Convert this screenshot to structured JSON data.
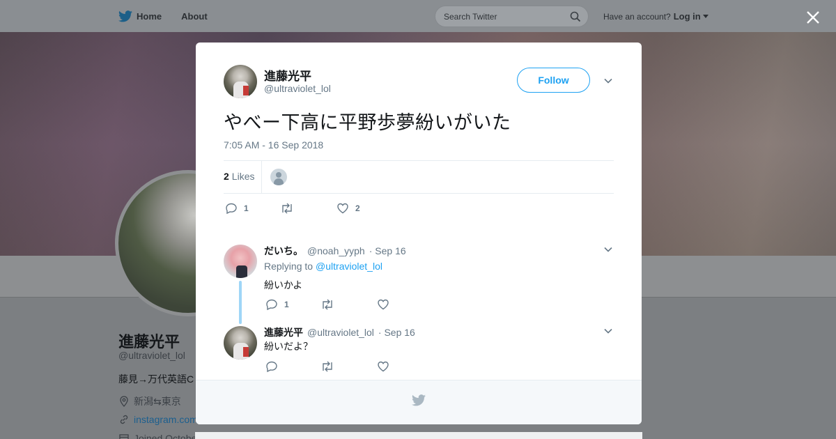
{
  "nav": {
    "home_label": "Home",
    "about_label": "About",
    "search_placeholder": "Search Twitter",
    "account_prompt": "Have an account?",
    "login_label": "Log in"
  },
  "background_profile": {
    "name": "進藤光平",
    "handle": "@ultraviolet_lol",
    "bio": "藤見→万代英語C",
    "location": "新潟⇆東京",
    "website": "instagram.com",
    "joined": "Joined Octobe"
  },
  "tweet": {
    "author_name": "進藤光平",
    "author_handle": "@ultraviolet_lol",
    "follow_label": "Follow",
    "text": "やべー下高に平野歩夢紛いがいた",
    "timestamp": "7:05 AM - 16 Sep 2018",
    "likes_count": "2",
    "likes_label": "Likes",
    "reply_count": "1",
    "like_count_action": "2"
  },
  "replies": [
    {
      "name": "だいち。",
      "handle": "@noah_yyph",
      "date": "· Sep 16",
      "replying_label": "Replying to",
      "replying_to": "@ultraviolet_lol",
      "text": "紛いかよ",
      "reply_count": "1"
    },
    {
      "name": "進藤光平",
      "handle": "@ultraviolet_lol",
      "date": "· Sep 16",
      "text": "紛いだよ？"
    }
  ],
  "colors": {
    "accent": "#1da1f2",
    "thread_line": "#9fd6f7",
    "secondary_text": "#657786",
    "primary_text": "#14171a"
  }
}
